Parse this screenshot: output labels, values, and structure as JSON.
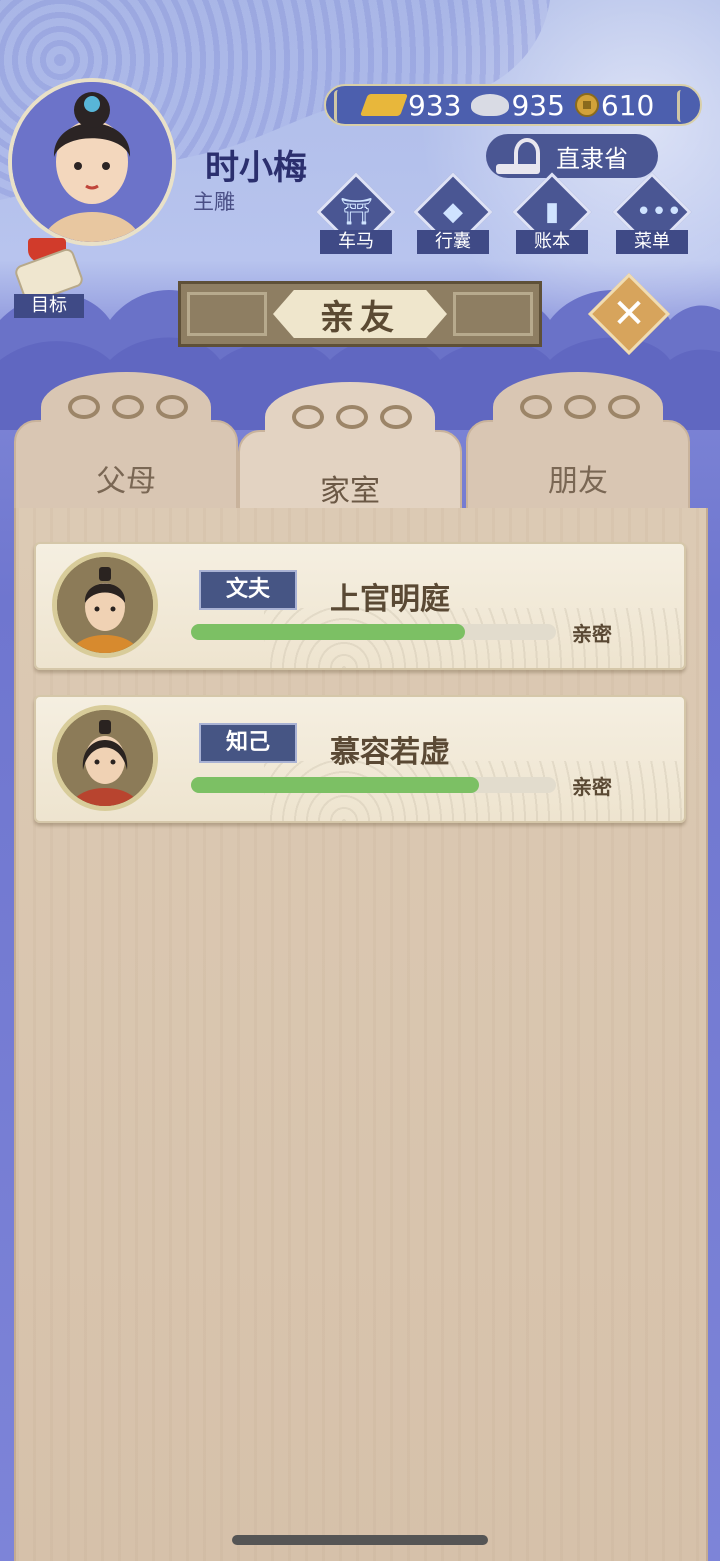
{
  "player": {
    "name": "时小梅",
    "title": "主雕"
  },
  "currency": [
    {
      "icon": "gold-bar-icon",
      "value": "933"
    },
    {
      "icon": "silver-ingot-icon",
      "value": "935"
    },
    {
      "icon": "copper-coin-icon",
      "value": "610"
    }
  ],
  "region": {
    "label": "直隶省"
  },
  "menu": [
    {
      "label": "车马",
      "icon": "carriage-icon"
    },
    {
      "label": "行囊",
      "icon": "bag-icon"
    },
    {
      "label": "账本",
      "icon": "ledger-icon"
    },
    {
      "label": "菜单",
      "icon": "more-icon"
    }
  ],
  "goal": {
    "label": "目标"
  },
  "screen_title": "亲友",
  "tabs": [
    {
      "label": "父母",
      "active": false
    },
    {
      "label": "家室",
      "active": true
    },
    {
      "label": "朋友",
      "active": false
    }
  ],
  "relations": [
    {
      "role": "文夫",
      "name": "上官明庭",
      "intimacy_label": "亲密",
      "intimacy": 0.75
    },
    {
      "role": "知己",
      "name": "慕容若虚",
      "intimacy_label": "亲密",
      "intimacy": 0.79
    }
  ],
  "colors": {
    "accent": "#4a5693",
    "intimacy_bar": "#7cc064",
    "panel": "#dccab4"
  }
}
